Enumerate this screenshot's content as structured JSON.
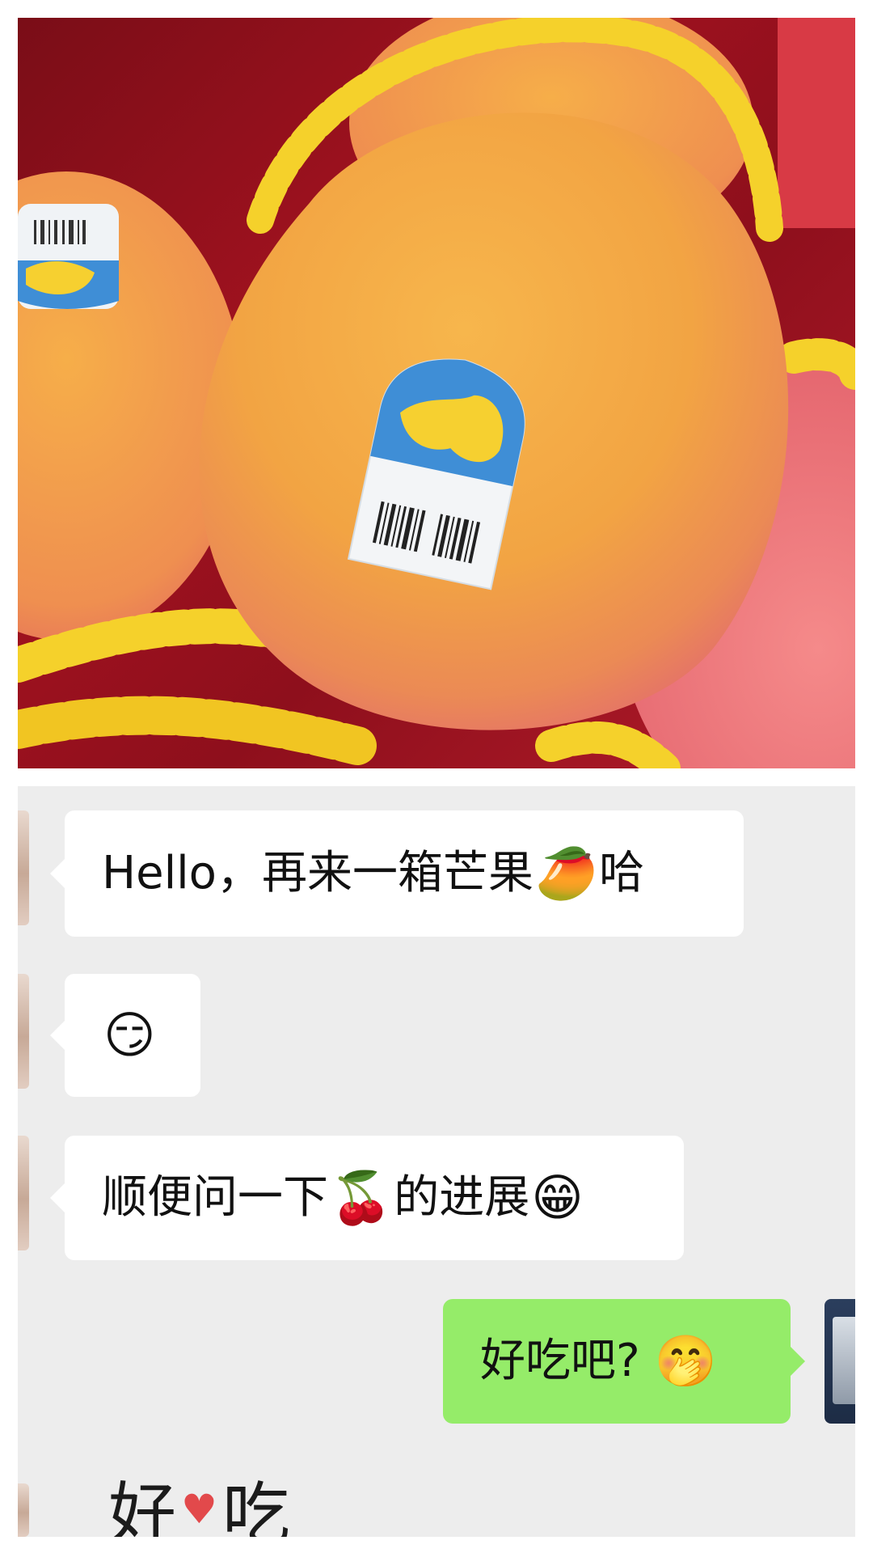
{
  "chat": {
    "messages": [
      {
        "side": "left",
        "text": "Hello，再来一箱芒果",
        "emoji": "🥭",
        "tail": "哈"
      },
      {
        "side": "left",
        "emoji": "😏"
      },
      {
        "side": "left",
        "text": "顺便问一下",
        "emoji": "🍒",
        "tail": "的进展",
        "emoji2": "😁"
      },
      {
        "side": "right",
        "text": "好吃吧?",
        "emoji": "🤭"
      }
    ],
    "sticker": {
      "left": "好",
      "heart": "♥",
      "right": "吃"
    }
  },
  "colors": {
    "chat_bg": "#ededed",
    "incoming_bubble": "#ffffff",
    "outgoing_bubble": "#95ec69"
  }
}
